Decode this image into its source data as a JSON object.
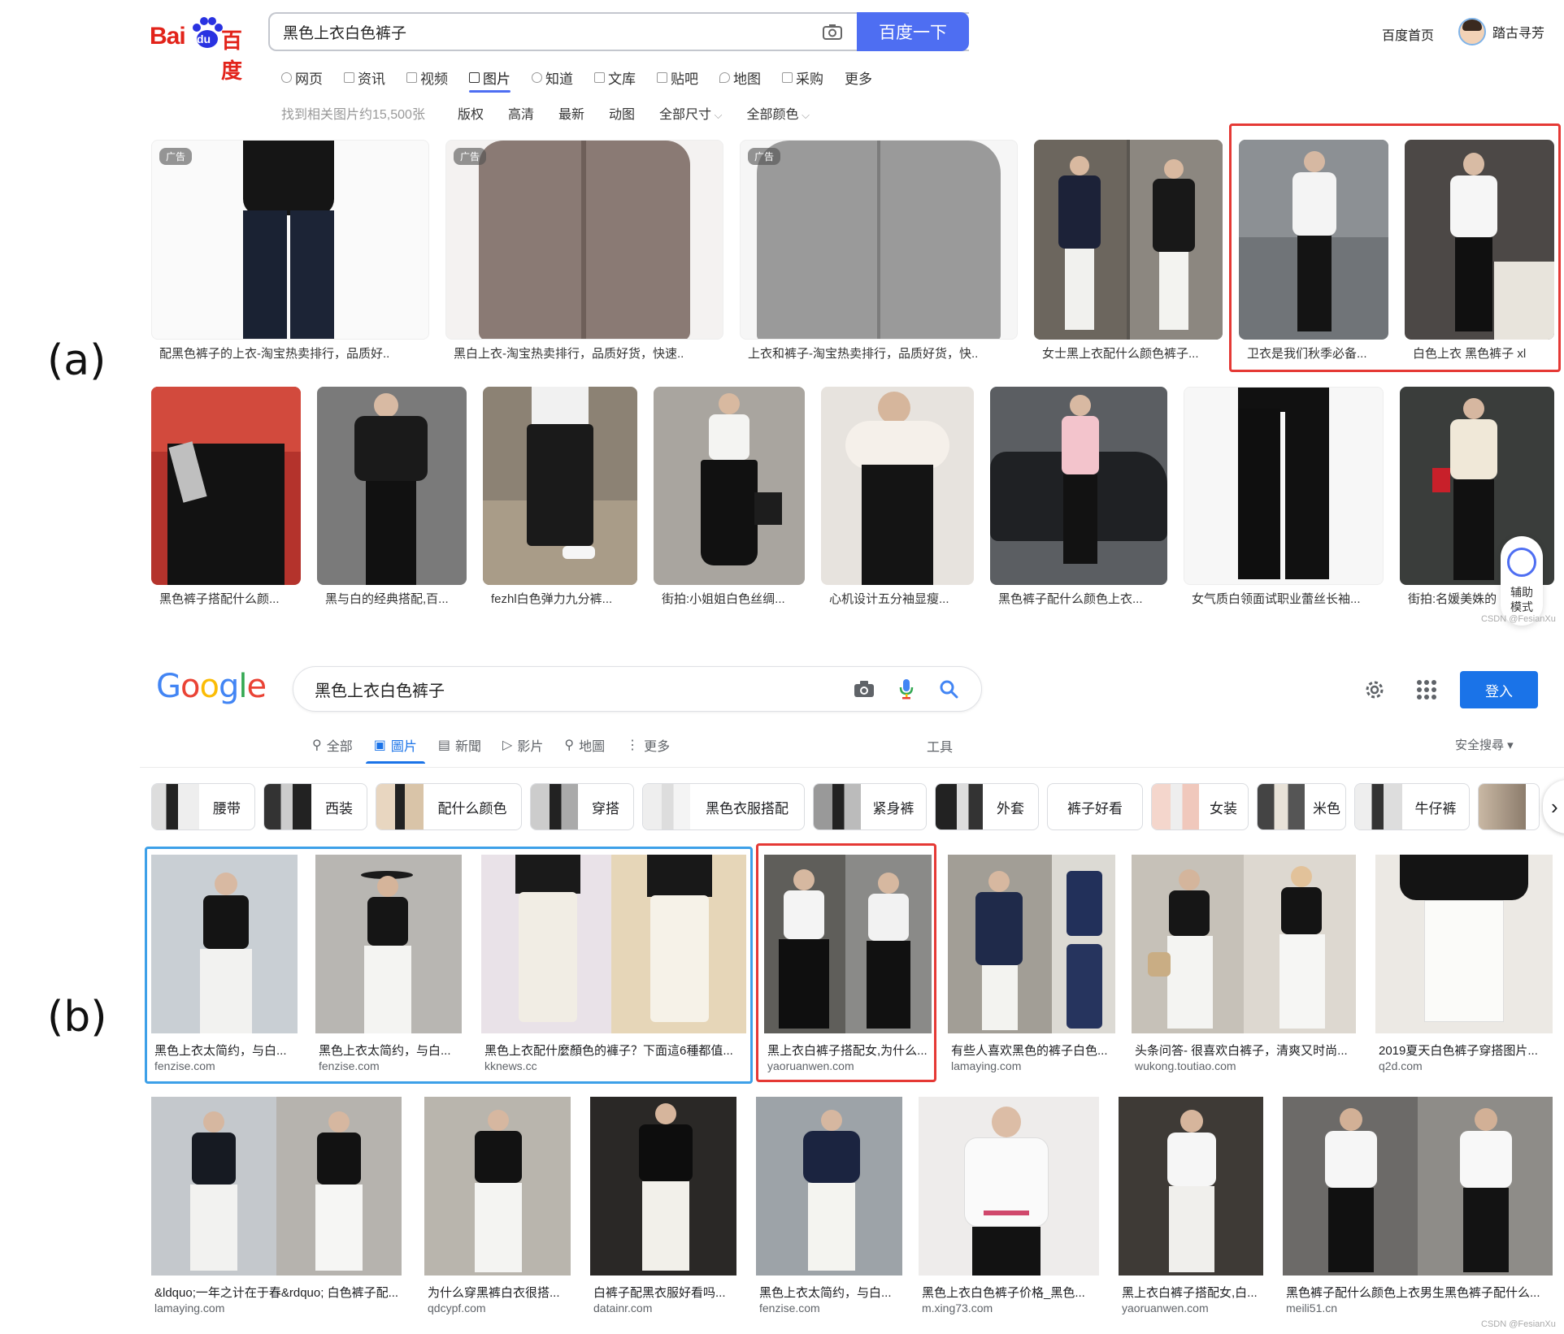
{
  "labels": {
    "a": "(a)",
    "b": "(b)"
  },
  "baidu": {
    "logo": {
      "bai": "Bai",
      "du": "du",
      "cn": "百度"
    },
    "query": "黑色上衣白色裤子",
    "search_button": "百度一下",
    "home_link": "百度首页",
    "username": "踏古寻芳",
    "tabs": [
      "网页",
      "资讯",
      "视频",
      "图片",
      "知道",
      "文库",
      "贴吧",
      "地图",
      "采购",
      "更多"
    ],
    "active_tab": "图片",
    "result_count": "找到相关图片约15,500张",
    "filters": [
      "版权",
      "高清",
      "最新",
      "动图",
      "全部尺寸",
      "全部颜色"
    ],
    "ad_label": "广告",
    "row1": [
      "配黑色裤子的上衣-淘宝热卖排行，品质好..",
      "黑白上衣-淘宝热卖排行，品质好货，快速..",
      "上衣和裤子-淘宝热卖排行，品质好货，快..",
      "女士黑上衣配什么颜色裤子...",
      "卫衣是我们秋季必备...",
      "白色上衣 黑色裤子 xl"
    ],
    "row2": [
      "黑色裤子搭配什么颜...",
      "黑与白的经典搭配,百...",
      "fezhl白色弹力九分裤...",
      "街拍:小姐姐白色丝绸...",
      "心机设计五分袖显瘦...",
      "黑色裤子配什么颜色上衣...",
      "女气质白领面试职业蕾丝长袖...",
      "街拍:名媛美姝的"
    ],
    "assist_label": "辅助\n模式",
    "watermark": "CSDN @FesianXu"
  },
  "google": {
    "logo_letters": [
      "G",
      "o",
      "o",
      "g",
      "l",
      "e"
    ],
    "logo_colors": [
      "#4285F4",
      "#EA4335",
      "#FBBC05",
      "#4285F4",
      "#34A853",
      "#EA4335"
    ],
    "query": "黑色上衣白色裤子",
    "login_button": "登入",
    "tabs": [
      "全部",
      "圖片",
      "新聞",
      "影片",
      "地圖",
      "更多"
    ],
    "active_tab": "圖片",
    "tools": "工具",
    "safe_search": "安全搜尋 ▾",
    "chips": [
      "腰带",
      "西装",
      "配什么颜色",
      "穿搭",
      "黑色衣服搭配",
      "紧身裤",
      "外套",
      "裤子好看",
      "女装",
      "米色",
      "牛仔裤"
    ],
    "row1": [
      {
        "caption": "黑色上衣太简约，与白...",
        "source": "fenzise.com"
      },
      {
        "caption": "黑色上衣太简约，与白...",
        "source": "fenzise.com"
      },
      {
        "caption": "黑色上衣配什麼顏色的褲子？下面這6種都值...",
        "source": "kknews.cc"
      },
      {
        "caption": "黑上衣白裤子搭配女,为什么...",
        "source": "yaoruanwen.com"
      },
      {
        "caption": "有些人喜欢黑色的裤子白色...",
        "source": "lamaying.com"
      },
      {
        "caption": "头条问答- 很喜欢白裤子，清爽又时尚...",
        "source": "wukong.toutiao.com"
      },
      {
        "caption": "2019夏天白色裤子穿搭图片...",
        "source": "q2d.com"
      }
    ],
    "row2": [
      {
        "caption": "&ldquo;一年之计在于春&rdquo; 白色裤子配...",
        "source": "lamaying.com"
      },
      {
        "caption": "为什么穿黑裤白衣很搭...",
        "source": "qdcypf.com"
      },
      {
        "caption": "白裤子配黑衣服好看吗...",
        "source": "datainr.com"
      },
      {
        "caption": "黑色上衣太简约，与白...",
        "source": "fenzise.com"
      },
      {
        "caption": "黑色上衣白色裤子价格_黑色...",
        "source": "m.xing73.com"
      },
      {
        "caption": "黑上衣白裤子搭配女,白...",
        "source": "yaoruanwen.com"
      },
      {
        "caption": "黑色裤子配什么颜色上衣男生黑色裤子配什么...",
        "source": "meili51.cn"
      }
    ],
    "watermark": "CSDN @FesianXu"
  }
}
